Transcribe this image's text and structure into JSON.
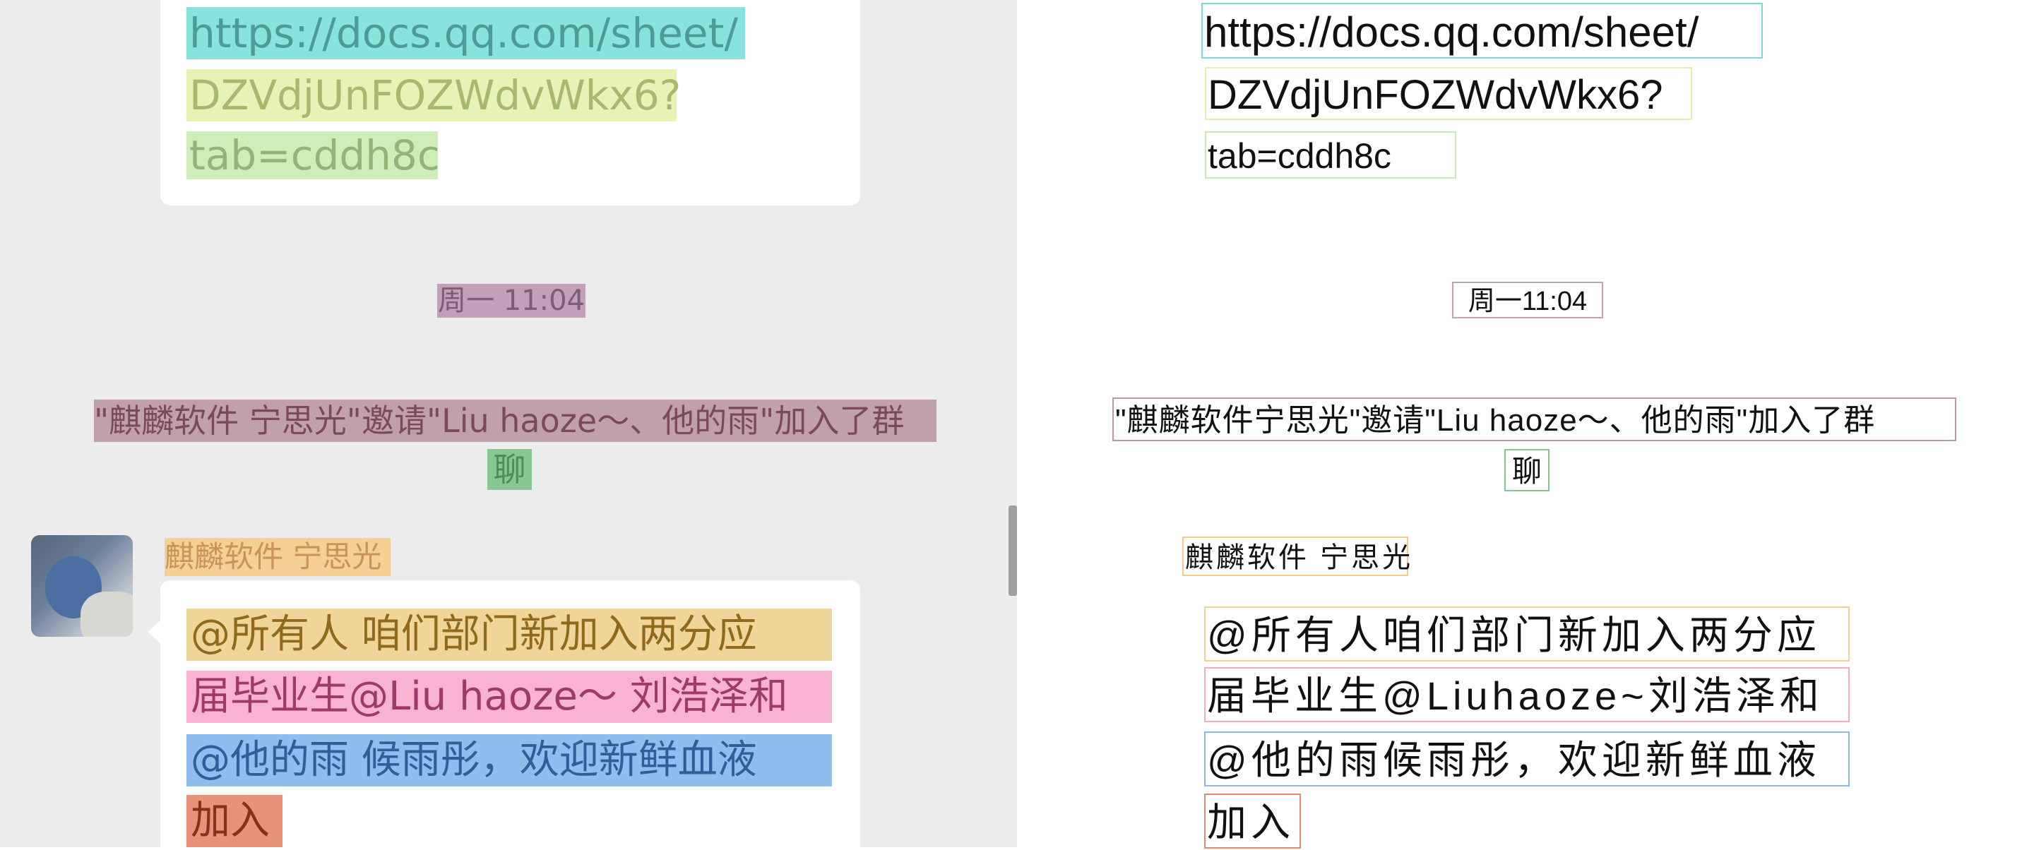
{
  "chat": {
    "url_lines": [
      "https://docs.qq.com/sheet/",
      "DZVdjUnFOZWdvWkx6?",
      "tab=cddh8c"
    ],
    "timestamp": "周一 11:04",
    "system_line1": "\"麒麟软件 宁思光\"邀请\"Liu haoze～、他的雨\"加入了群",
    "system_line2": "聊",
    "sender": "麒麟软件 宁思光",
    "message_lines": [
      "@所有人  咱们部门新加入两分应",
      "届毕业生@Liu haoze～ 刘浩泽和",
      "@他的雨  候雨彤，欢迎新鲜血液",
      "加入"
    ]
  },
  "ocr": {
    "url_lines": [
      "https://docs.qq.com/sheet/",
      "DZVdjUnFOZWdvWkx6?",
      "tab=cddh8c"
    ],
    "timestamp": "周一11:04",
    "system_line1": "\"麒麟软件宁思光\"邀请\"Liu haoze～、他的雨\"加入了群",
    "system_line2": "聊",
    "sender": "麒麟软件 宁思光",
    "message_lines": [
      "@所有人咱们部门新加入两分应",
      "届毕业生@Liuhaoze~刘浩泽和",
      "@他的雨候雨彤，欢迎新鲜血液",
      "加入"
    ]
  },
  "colors": {
    "chat_background": "#ececec",
    "bubble": "#ffffff",
    "url1_highlight": "#88e3dc",
    "url2_highlight": "#e7f3b5",
    "url3_highlight": "#cdedb9",
    "timestamp_highlight": "#c1a1b9",
    "system_highlight": "#c0a1aa",
    "system2_highlight": "#87c794",
    "sender_highlight": "#f5cf94",
    "msg1_highlight": "#efd59a",
    "msg2_highlight": "#f9b2d2",
    "msg3_highlight": "#8fbdee",
    "msg4_highlight": "#e9927a"
  },
  "icons": {
    "avatar": "user-avatar-photo"
  }
}
